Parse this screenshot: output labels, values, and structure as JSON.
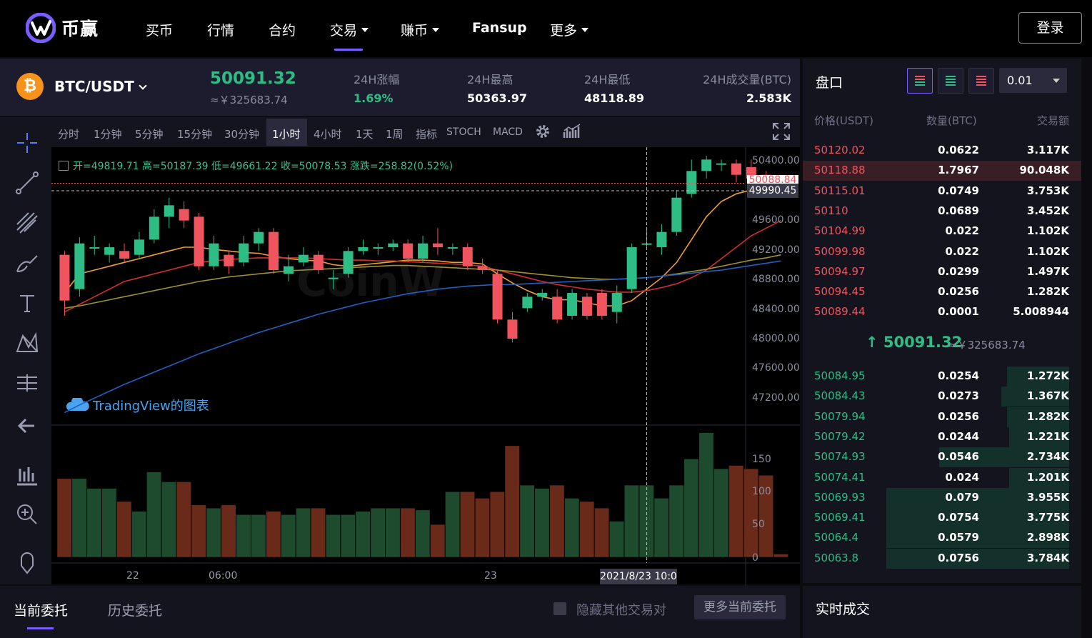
{
  "app": {
    "logo_text": "币赢"
  },
  "nav": {
    "items": [
      {
        "label": "买币",
        "dropdown": false
      },
      {
        "label": "行情",
        "dropdown": false
      },
      {
        "label": "合约",
        "dropdown": false
      },
      {
        "label": "交易",
        "dropdown": true,
        "active": true
      },
      {
        "label": "赚币",
        "dropdown": true
      },
      {
        "label": "Fansup",
        "dropdown": false
      },
      {
        "label": "更多",
        "dropdown": true
      }
    ],
    "login_label": "登录"
  },
  "ticker": {
    "pair": "BTC/USDT",
    "coin_symbol": "₿",
    "last_price": "50091.32",
    "cny_price": "≈￥325683.74",
    "stats": [
      {
        "label": "24H涨幅",
        "value": "1.69%",
        "color": "#2ebd85"
      },
      {
        "label": "24H最高",
        "value": "50363.97",
        "color": "#ffffff"
      },
      {
        "label": "24H最低",
        "value": "48118.89",
        "color": "#ffffff"
      },
      {
        "label": "24H成交量(BTC)",
        "value": "2.583K",
        "color": "#ffffff"
      }
    ]
  },
  "chart_toolbar": {
    "intervals": [
      "分时",
      "1分钟",
      "5分钟",
      "15分钟",
      "30分钟",
      "1小时",
      "4小时",
      "1天",
      "1周"
    ],
    "active_interval": "1小时",
    "indicator_label": "指标",
    "indicators": [
      "STOCH",
      "MACD"
    ],
    "settings_icon": "gear-icon",
    "chart_type_icon": "chart-type-icon"
  },
  "left_tools": [
    "crosshair-icon",
    "trend-line-icon",
    "pitchfork-icon",
    "brush-icon",
    "text-tool-icon",
    "pattern-icon",
    "measure-icon",
    "arrow-back-icon",
    "candles-icon",
    "zoom-in-icon",
    "magnet-icon"
  ],
  "ohlc": {
    "text": "开=49819.71  高=50187.39  低=49661.22  收=50078.53  涨跌=258.82(0.52%)"
  },
  "watermarks": {
    "tradingview": "TradingView的图表",
    "coinw": "CoinW"
  },
  "chart_data": {
    "type": "candlestick",
    "y_axis_labels": [
      "50400.00",
      "49600.00",
      "49200.00",
      "48800.00",
      "48400.00",
      "48000.00",
      "47600.00",
      "47200.00"
    ],
    "ylim": [
      47000,
      50450
    ],
    "price_tags": {
      "last": "50088.84",
      "crosshair": "49990.45"
    },
    "volume_axis_labels": [
      "150",
      "100",
      "50",
      "0"
    ],
    "vol_lim": [
      0,
      195
    ],
    "x_labels": [
      "22",
      "06:00",
      "23"
    ],
    "crosshair_time": "2021/8/23 10:0",
    "candles": [
      [
        49150,
        48550,
        49200,
        48350
      ],
      [
        48700,
        49300,
        49380,
        48600
      ],
      [
        49250,
        49250,
        49400,
        49150
      ],
      [
        49150,
        49250,
        49300,
        49050
      ],
      [
        49200,
        49100,
        49300,
        49050
      ],
      [
        49150,
        49350,
        49450,
        49100
      ],
      [
        49350,
        49650,
        49750,
        49300
      ],
      [
        49650,
        49800,
        49900,
        49500
      ],
      [
        49750,
        49600,
        49850,
        49500
      ],
      [
        49650,
        49000,
        49700,
        48950
      ],
      [
        49000,
        49300,
        49400,
        48950
      ],
      [
        49150,
        49000,
        49200,
        48900
      ],
      [
        49050,
        49300,
        49400,
        49000
      ],
      [
        49300,
        49450,
        49500,
        49200
      ],
      [
        49450,
        48950,
        49500,
        48900
      ],
      [
        48900,
        49000,
        49150,
        48800
      ],
      [
        49050,
        49150,
        49250,
        49000
      ],
      [
        49150,
        48950,
        49200,
        48900
      ],
      [
        48850,
        48850,
        48950,
        48700
      ],
      [
        48900,
        49200,
        49250,
        48850
      ],
      [
        49200,
        49250,
        49350,
        49150
      ],
      [
        49250,
        49250,
        49300,
        49150
      ],
      [
        49250,
        49300,
        49350,
        49200
      ],
      [
        49300,
        49100,
        49350,
        49050
      ],
      [
        49100,
        49300,
        49400,
        49050
      ],
      [
        49300,
        49250,
        49500,
        49150
      ],
      [
        49250,
        49250,
        49300,
        49150
      ],
      [
        49250,
        49000,
        49300,
        48950
      ],
      [
        49000,
        48950,
        49100,
        48900
      ],
      [
        48900,
        48300,
        48950,
        48250
      ],
      [
        48300,
        48050,
        48400,
        48000
      ],
      [
        48450,
        48600,
        48650,
        48400
      ],
      [
        48600,
        48650,
        48700,
        48550
      ],
      [
        48600,
        48300,
        48700,
        48250
      ],
      [
        48350,
        48650,
        48700,
        48300
      ],
      [
        48600,
        48350,
        48650,
        48300
      ],
      [
        48650,
        48350,
        48700,
        48300
      ],
      [
        48400,
        48650,
        48750,
        48250
      ],
      [
        48700,
        49250,
        49300,
        48650
      ],
      [
        49300,
        49300,
        49500,
        49250
      ],
      [
        49250,
        49450,
        49550,
        49150
      ],
      [
        49450,
        49900,
        50000,
        49400
      ],
      [
        49950,
        50250,
        50400,
        49900
      ],
      [
        50250,
        50400,
        50450,
        50150
      ],
      [
        50350,
        50350,
        50400,
        50250
      ],
      [
        50350,
        50200,
        50400,
        50100
      ],
      [
        50300,
        50150,
        50400,
        50050
      ],
      [
        50200,
        50100,
        50250,
        50050
      ],
      [
        50100,
        50070,
        50150,
        50000
      ]
    ],
    "volumes": [
      120,
      120,
      105,
      105,
      85,
      70,
      130,
      115,
      115,
      80,
      75,
      80,
      65,
      65,
      70,
      65,
      75,
      75,
      65,
      65,
      70,
      75,
      75,
      75,
      72,
      50,
      100,
      100,
      90,
      100,
      170,
      110,
      105,
      110,
      90,
      85,
      75,
      55,
      110,
      110,
      90,
      110,
      150,
      190,
      135,
      140,
      135,
      125,
      5
    ],
    "ma_series": [
      {
        "values": [
          48650,
          48900,
          48950,
          49000,
          49050,
          49100,
          49150,
          49200,
          49250,
          49250,
          49220,
          49200,
          49180,
          49170,
          49130,
          49100,
          49080,
          49070,
          49020,
          49000,
          49020,
          49040,
          49060,
          49080,
          49080,
          49070,
          49050,
          49050,
          49030,
          48900,
          48780,
          48680,
          48600,
          48560,
          48560,
          48520,
          48480,
          48480,
          48550,
          48700,
          48850,
          49050,
          49350,
          49650,
          49850,
          49950,
          50000,
          50050,
          50050
        ],
        "color": "#f0a030"
      },
      {
        "values": [
          48400,
          48500,
          48600,
          48700,
          48800,
          48850,
          48900,
          48950,
          49000,
          49050,
          49070,
          49090,
          49100,
          49110,
          49110,
          49110,
          49110,
          49100,
          49090,
          49080,
          49080,
          49070,
          49070,
          49060,
          49050,
          49040,
          49030,
          49020,
          49000,
          48950,
          48900,
          48850,
          48800,
          48760,
          48730,
          48700,
          48680,
          48660,
          48660,
          48680,
          48720,
          48770,
          48850,
          48950,
          49100,
          49250,
          49400,
          49500,
          49600
        ],
        "color": "#d03030"
      },
      {
        "values": [
          48450,
          48480,
          48520,
          48560,
          48600,
          48640,
          48680,
          48720,
          48760,
          48800,
          48830,
          48860,
          48880,
          48900,
          48920,
          48940,
          48950,
          48960,
          48970,
          48980,
          48990,
          49000,
          49010,
          49010,
          49000,
          48990,
          48980,
          48970,
          48960,
          48950,
          48930,
          48910,
          48890,
          48870,
          48850,
          48840,
          48830,
          48830,
          48840,
          48850,
          48870,
          48900,
          48930,
          48960,
          49000,
          49040,
          49080,
          49110,
          49150
        ],
        "color": "#a09030"
      },
      {
        "values": [
          47080,
          47180,
          47270,
          47360,
          47450,
          47530,
          47610,
          47690,
          47770,
          47850,
          47920,
          47990,
          48060,
          48130,
          48190,
          48250,
          48310,
          48370,
          48420,
          48470,
          48520,
          48560,
          48600,
          48640,
          48670,
          48700,
          48720,
          48740,
          48750,
          48760,
          48760,
          48770,
          48780,
          48790,
          48800,
          48810,
          48820,
          48830,
          48840,
          48850,
          48870,
          48890,
          48910,
          48930,
          48950,
          48980,
          49010,
          49040,
          49070
        ],
        "color": "#2060c0"
      }
    ],
    "colors": {
      "up": "#2ebd85",
      "down": "#f0545f",
      "vol_up": "#1e4a2e",
      "vol_down": "#6a2a1a"
    }
  },
  "orders": {
    "tabs": [
      "当前委托",
      "历史委托"
    ],
    "active_tab": "当前委托",
    "hide_label": "隐藏其他交易对",
    "more_label": "更多当前委托"
  },
  "order_book": {
    "title": "盘口",
    "precision": "0.01",
    "columns": [
      "价格(USDT)",
      "数量(BTC)",
      "交易额"
    ],
    "asks": [
      {
        "price": "50120.02",
        "qty": "0.0622",
        "total": "3.117K",
        "depth": 0.0,
        "highlight": false
      },
      {
        "price": "50118.88",
        "qty": "1.7967",
        "total": "90.048K",
        "depth": 1.0,
        "highlight": true
      },
      {
        "price": "50115.01",
        "qty": "0.0749",
        "total": "3.753K",
        "depth": 0.0,
        "highlight": false
      },
      {
        "price": "50110",
        "qty": "0.0689",
        "total": "3.452K",
        "depth": 0.0,
        "highlight": false
      },
      {
        "price": "50104.99",
        "qty": "0.022",
        "total": "1.102K",
        "depth": 0.0,
        "highlight": false
      },
      {
        "price": "50099.98",
        "qty": "0.022",
        "total": "1.102K",
        "depth": 0.0,
        "highlight": false
      },
      {
        "price": "50094.97",
        "qty": "0.0299",
        "total": "1.497K",
        "depth": 0.0,
        "highlight": false
      },
      {
        "price": "50094.45",
        "qty": "0.0256",
        "total": "1.282K",
        "depth": 0.0,
        "highlight": false
      },
      {
        "price": "50089.44",
        "qty": "0.0001",
        "total": "5.008944",
        "depth": 0.0,
        "highlight": false
      }
    ],
    "mid_price": "↑ 50091.32",
    "mid_cny": "≈￥325683.74",
    "bids": [
      {
        "price": "50084.95",
        "qty": "0.0254",
        "total": "1.272K",
        "depth": 0.34
      },
      {
        "price": "50084.43",
        "qty": "0.0273",
        "total": "1.367K",
        "depth": 0.37
      },
      {
        "price": "50079.94",
        "qty": "0.0256",
        "total": "1.282K",
        "depth": 0.34
      },
      {
        "price": "50079.42",
        "qty": "0.0244",
        "total": "1.221K",
        "depth": 0.33
      },
      {
        "price": "50074.93",
        "qty": "0.0546",
        "total": "2.734K",
        "depth": 0.71
      },
      {
        "price": "50074.41",
        "qty": "0.024",
        "total": "1.201K",
        "depth": 0.33
      },
      {
        "price": "50069.93",
        "qty": "0.079",
        "total": "3.955K",
        "depth": 1.0
      },
      {
        "price": "50069.41",
        "qty": "0.0754",
        "total": "3.775K",
        "depth": 1.0
      },
      {
        "price": "50064.4",
        "qty": "0.0579",
        "total": "2.898K",
        "depth": 1.0
      },
      {
        "price": "50063.8",
        "qty": "0.0756",
        "total": "3.784K",
        "depth": 1.0
      }
    ]
  },
  "trades": {
    "title": "实时成交"
  }
}
